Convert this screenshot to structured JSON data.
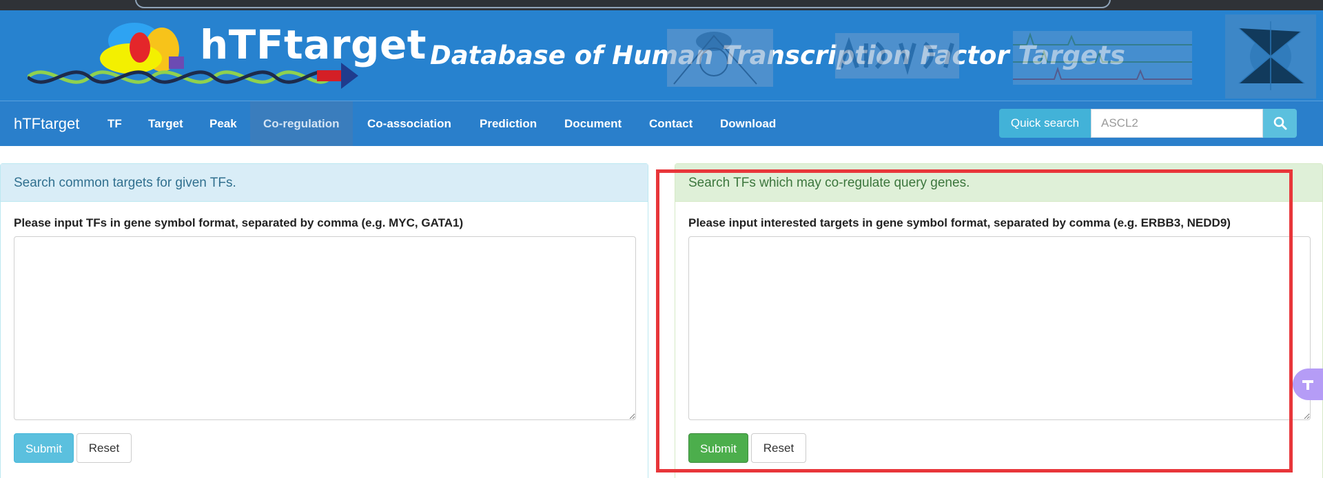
{
  "header": {
    "logo_text": "hTFtarget",
    "tagline": "Database of Human Transcription Factor Targets"
  },
  "navbar": {
    "brand": "hTFtarget",
    "items": [
      {
        "label": "TF"
      },
      {
        "label": "Target"
      },
      {
        "label": "Peak"
      },
      {
        "label": "Co-regulation",
        "active": true
      },
      {
        "label": "Co-association"
      },
      {
        "label": "Prediction"
      },
      {
        "label": "Document"
      },
      {
        "label": "Contact"
      },
      {
        "label": "Download"
      }
    ],
    "quick_search": {
      "button_label": "Quick search",
      "placeholder": "ASCL2",
      "go_icon": "search-icon"
    }
  },
  "left_panel": {
    "heading": "Search common targets for given TFs.",
    "label": "Please input TFs in gene symbol format, separated by comma (e.g. MYC, GATA1)",
    "submit_label": "Submit",
    "reset_label": "Reset"
  },
  "right_panel": {
    "heading": "Search TFs which may co-regulate query genes.",
    "label": "Please input interested targets in gene symbol format, separated by comma (e.g. ERBB3, NEDD9)",
    "submit_label": "Submit",
    "reset_label": "Reset"
  },
  "colors": {
    "banner": "#2782cf",
    "navbar": "#2a7fcb",
    "info_panel": "#d9edf7",
    "success_panel": "#dff0d8",
    "submit_info": "#5bc0de",
    "submit_success": "#4cae4c",
    "highlight": "#e8363a"
  }
}
